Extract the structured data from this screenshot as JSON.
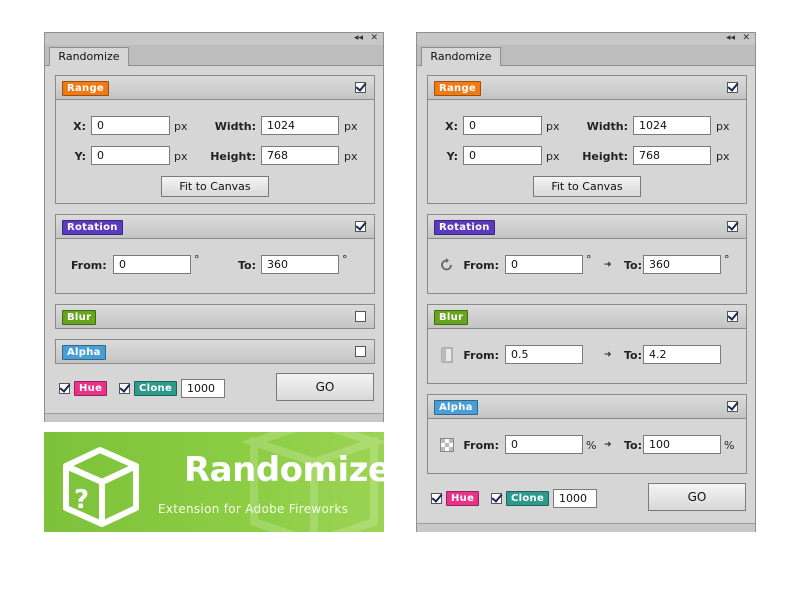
{
  "colors": {
    "range": "#f07b16",
    "rotation": "#5b3bbd",
    "blur": "#66a51f",
    "alpha": "#4a9ed6",
    "hue": "#e9338a",
    "clone": "#2e9a8c",
    "banner_green": "#86c840"
  },
  "window_buttons": {
    "collapse": "◂◂",
    "close": "✕"
  },
  "left_panel": {
    "tab": "Randomize",
    "range": {
      "label": "Range",
      "checked": true,
      "x_label": "X:",
      "x_value": "0",
      "x_unit": "px",
      "y_label": "Y:",
      "y_value": "0",
      "y_unit": "px",
      "width_label": "Width:",
      "width_value": "1024",
      "width_unit": "px",
      "height_label": "Height:",
      "height_value": "768",
      "height_unit": "px",
      "fit_button": "Fit to Canvas"
    },
    "rotation": {
      "label": "Rotation",
      "checked": true,
      "from_label": "From:",
      "from_value": "0",
      "from_unit": "°",
      "to_label": "To:",
      "to_value": "360",
      "to_unit": "°"
    },
    "blur": {
      "label": "Blur",
      "checked": false
    },
    "alpha": {
      "label": "Alpha",
      "checked": false
    },
    "footer": {
      "hue_label": "Hue",
      "hue_checked": true,
      "clone_label": "Clone",
      "clone_checked": true,
      "clone_value": "1000",
      "go_button": "GO"
    }
  },
  "right_panel": {
    "tab": "Randomize",
    "range": {
      "label": "Range",
      "checked": true,
      "x_label": "X:",
      "x_value": "0",
      "x_unit": "px",
      "y_label": "Y:",
      "y_value": "0",
      "y_unit": "px",
      "width_label": "Width:",
      "width_value": "1024",
      "width_unit": "px",
      "height_label": "Height:",
      "height_value": "768",
      "height_unit": "px",
      "fit_button": "Fit to Canvas"
    },
    "rotation": {
      "label": "Rotation",
      "checked": true,
      "icon": "rotate-icon",
      "from_label": "From:",
      "from_value": "0",
      "from_unit": "°",
      "arrow": "➜",
      "to_label": "To:",
      "to_value": "360",
      "to_unit": "°"
    },
    "blur": {
      "label": "Blur",
      "checked": true,
      "icon": "blur-icon",
      "from_label": "From:",
      "from_value": "0.5",
      "arrow": "➜",
      "to_label": "To:",
      "to_value": "4.2"
    },
    "alpha": {
      "label": "Alpha",
      "checked": true,
      "icon": "transparency-icon",
      "from_label": "From:",
      "from_value": "0",
      "from_unit": "%",
      "arrow": "➜",
      "to_label": "To:",
      "to_value": "100",
      "to_unit": "%"
    },
    "footer": {
      "hue_label": "Hue",
      "hue_checked": true,
      "clone_label": "Clone",
      "clone_checked": true,
      "clone_value": "1000",
      "go_button": "GO"
    }
  },
  "banner": {
    "title": "Randomize",
    "subtitle": "Extension for Adobe Fireworks",
    "logo_icon": "question-cube-icon"
  }
}
